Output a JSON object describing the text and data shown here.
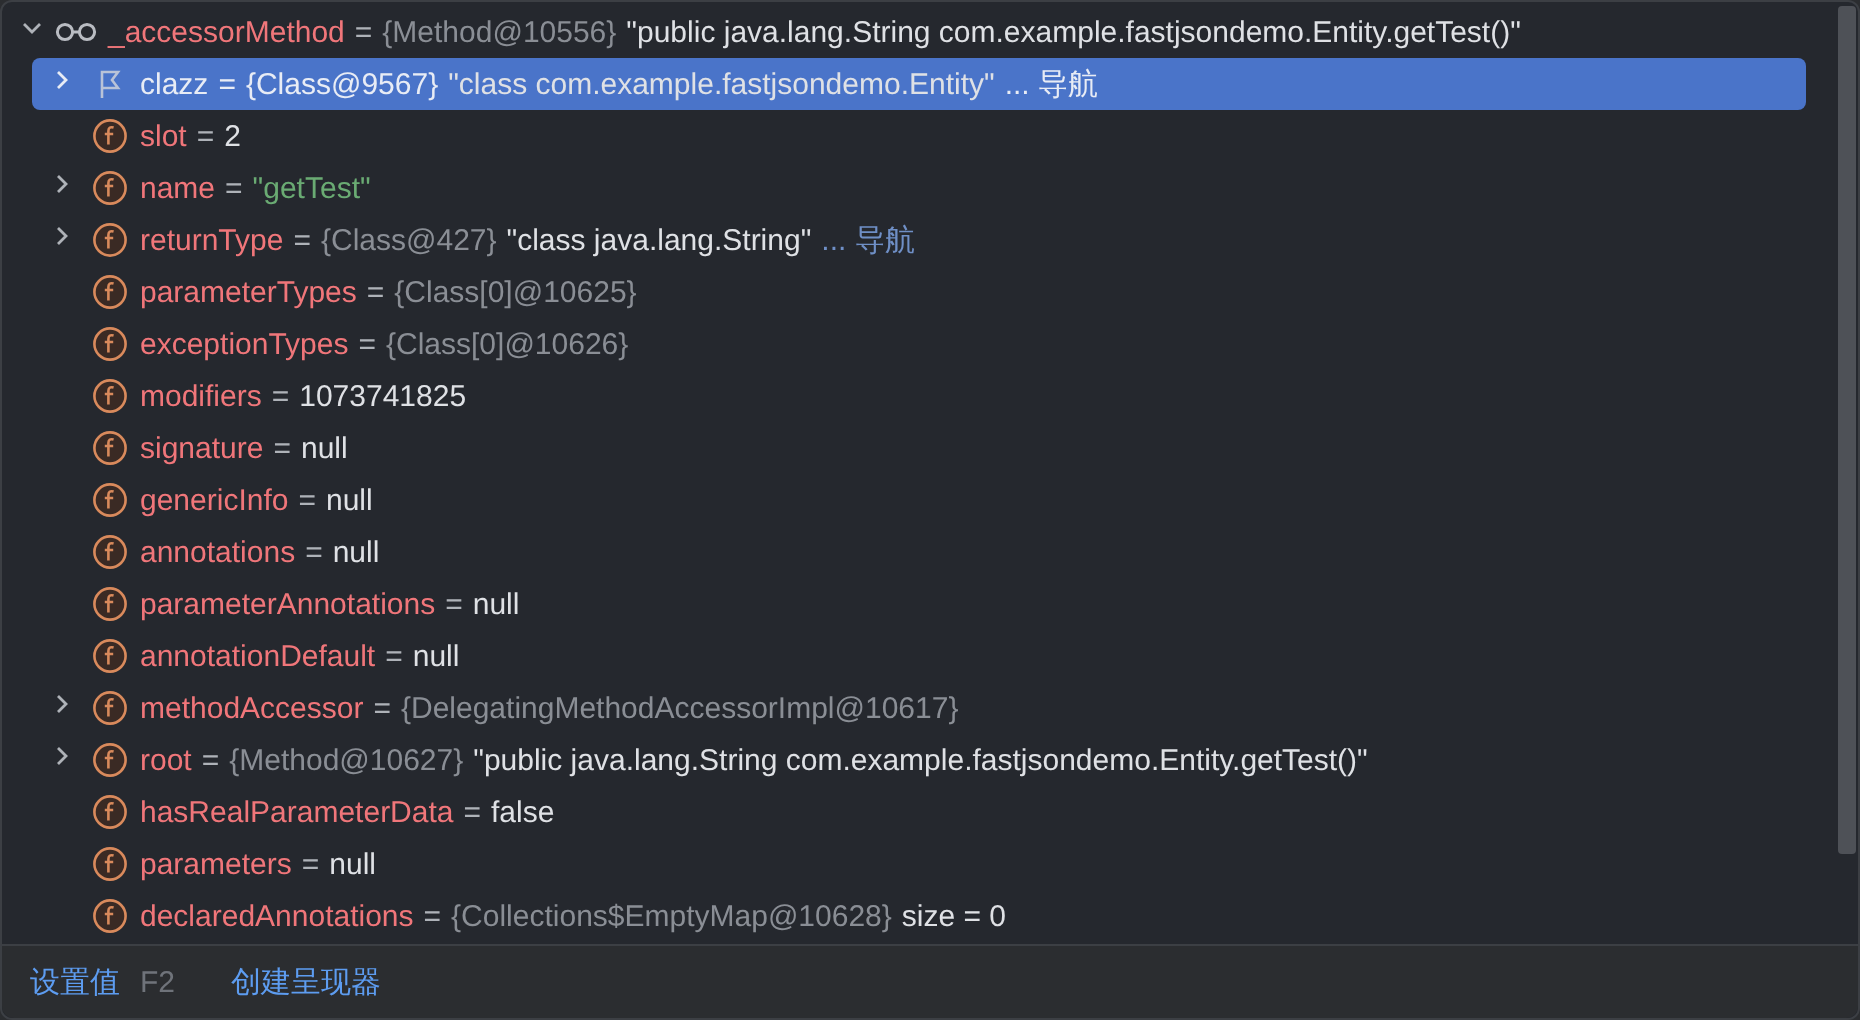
{
  "root": {
    "name": "_accessorMethod",
    "eq": "=",
    "type": "{Method@10556}",
    "value": "\"public java.lang.String com.example.fastjsondemo.Entity.getTest()\"",
    "expanded": true
  },
  "children": [
    {
      "kind": "flag",
      "name": "clazz",
      "eq": "=",
      "type": "{Class@9567}",
      "value": "\"class com.example.fastjsondemo.Entity\"",
      "is_string": false,
      "nav": "... 导航",
      "expandable": true,
      "selected": true
    },
    {
      "kind": "field",
      "name": "slot",
      "eq": "=",
      "value": "2",
      "is_string": false,
      "expandable": false,
      "selected": false
    },
    {
      "kind": "field",
      "name": "name",
      "eq": "=",
      "value": "\"getTest\"",
      "is_string": true,
      "expandable": true,
      "selected": false
    },
    {
      "kind": "field",
      "name": "returnType",
      "eq": "=",
      "type": "{Class@427}",
      "value": "\"class java.lang.String\"",
      "is_string": false,
      "nav": "... 导航",
      "expandable": true,
      "selected": false
    },
    {
      "kind": "field",
      "name": "parameterTypes",
      "eq": "=",
      "type": "{Class[0]@10625}",
      "expandable": false,
      "selected": false
    },
    {
      "kind": "field",
      "name": "exceptionTypes",
      "eq": "=",
      "type": "{Class[0]@10626}",
      "expandable": false,
      "selected": false
    },
    {
      "kind": "field",
      "name": "modifiers",
      "eq": "=",
      "value": "1073741825",
      "is_string": false,
      "expandable": false,
      "selected": false
    },
    {
      "kind": "field",
      "name": "signature",
      "eq": "=",
      "value": "null",
      "is_string": false,
      "expandable": false,
      "selected": false
    },
    {
      "kind": "field",
      "name": "genericInfo",
      "eq": "=",
      "value": "null",
      "is_string": false,
      "expandable": false,
      "selected": false
    },
    {
      "kind": "field",
      "name": "annotations",
      "eq": "=",
      "value": "null",
      "is_string": false,
      "expandable": false,
      "selected": false
    },
    {
      "kind": "field",
      "name": "parameterAnnotations",
      "eq": "=",
      "value": "null",
      "is_string": false,
      "expandable": false,
      "selected": false
    },
    {
      "kind": "field",
      "name": "annotationDefault",
      "eq": "=",
      "value": "null",
      "is_string": false,
      "expandable": false,
      "selected": false
    },
    {
      "kind": "field",
      "name": "methodAccessor",
      "eq": "=",
      "type": "{DelegatingMethodAccessorImpl@10617}",
      "expandable": true,
      "selected": false
    },
    {
      "kind": "field",
      "name": "root",
      "eq": "=",
      "type": "{Method@10627}",
      "value": "\"public java.lang.String com.example.fastjsondemo.Entity.getTest()\"",
      "is_string": false,
      "expandable": true,
      "selected": false
    },
    {
      "kind": "field",
      "name": "hasRealParameterData",
      "eq": "=",
      "value": "false",
      "is_string": false,
      "expandable": false,
      "selected": false
    },
    {
      "kind": "field",
      "name": "parameters",
      "eq": "=",
      "value": "null",
      "is_string": false,
      "expandable": false,
      "selected": false
    },
    {
      "kind": "field",
      "name": "declaredAnnotations",
      "eq": "=",
      "type": "{Collections$EmptyMap@10628}",
      "value": "size = 0",
      "is_string": false,
      "expandable": false,
      "selected": false
    }
  ],
  "footer": {
    "set_value": "设置值",
    "shortcut": "F2",
    "create_renderer": "创建呈现器"
  }
}
